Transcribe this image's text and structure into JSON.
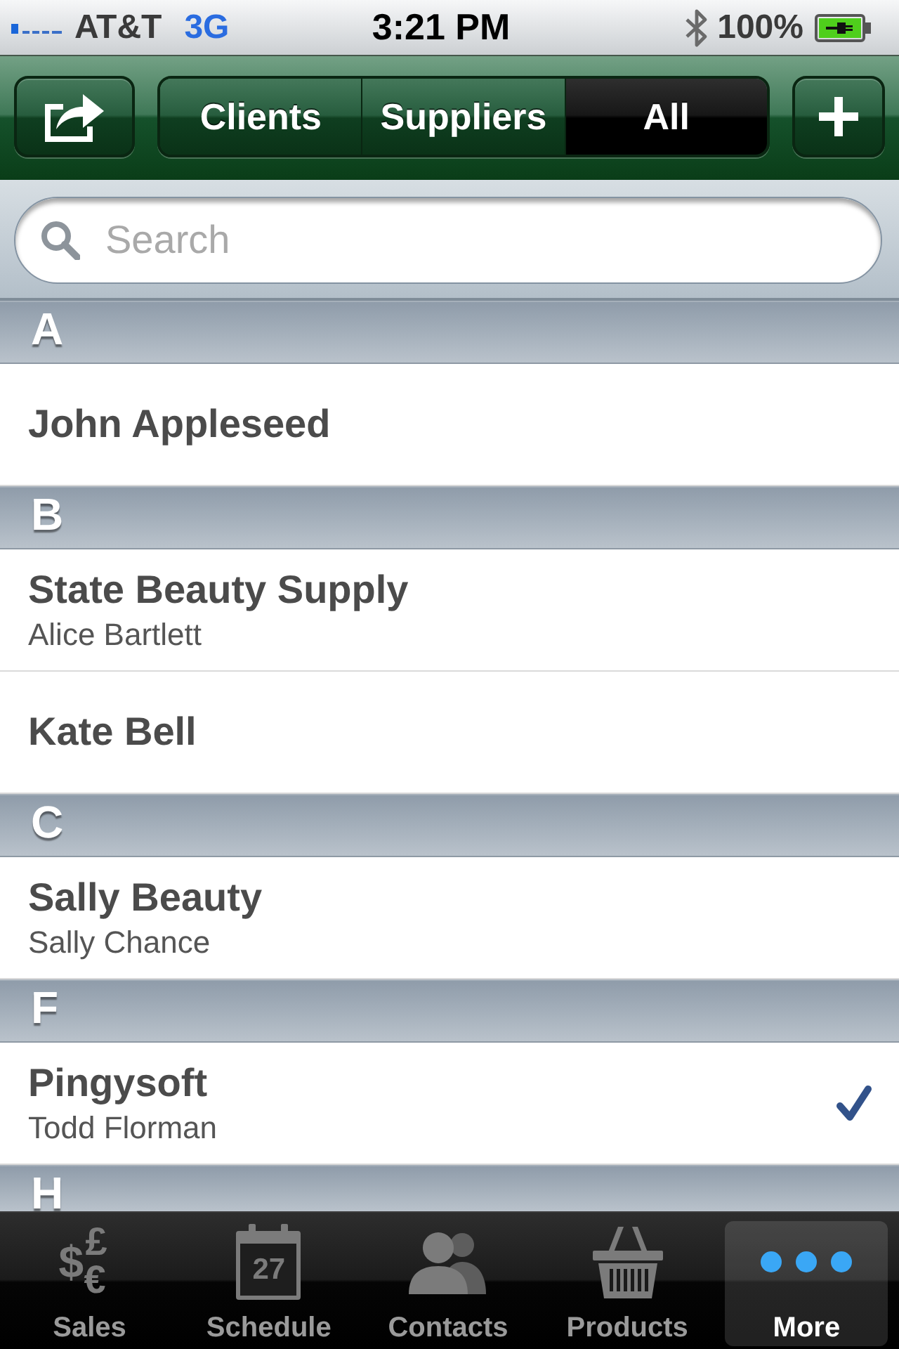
{
  "status_bar": {
    "carrier": "AT&T",
    "network": "3G",
    "time": "3:21 PM",
    "battery": "100%"
  },
  "nav_bar": {
    "segments": [
      {
        "label": "Clients",
        "selected": false
      },
      {
        "label": "Suppliers",
        "selected": false
      },
      {
        "label": "All",
        "selected": true
      }
    ]
  },
  "search": {
    "placeholder": "Search"
  },
  "sections": [
    {
      "letter": "A",
      "rows": [
        {
          "title": "John Appleseed",
          "checked": false
        }
      ]
    },
    {
      "letter": "B",
      "rows": [
        {
          "title": "State Beauty Supply",
          "subtitle": "Alice Bartlett",
          "checked": false
        },
        {
          "title": "Kate Bell",
          "checked": false
        }
      ]
    },
    {
      "letter": "C",
      "rows": [
        {
          "title": "Sally Beauty",
          "subtitle": "Sally Chance",
          "checked": false
        }
      ]
    },
    {
      "letter": "F",
      "rows": [
        {
          "title": "Pingysoft",
          "subtitle": "Todd Florman",
          "checked": true
        }
      ]
    },
    {
      "letter": "H"
    }
  ],
  "tab_bar": {
    "items": [
      {
        "label": "Sales",
        "selected": false,
        "icon_glyphs": [
          "$",
          "£",
          "€"
        ]
      },
      {
        "label": "Schedule",
        "selected": false,
        "icon_text": "27"
      },
      {
        "label": "Contacts",
        "selected": false
      },
      {
        "label": "Products",
        "selected": false
      },
      {
        "label": "More",
        "selected": true
      }
    ]
  }
}
